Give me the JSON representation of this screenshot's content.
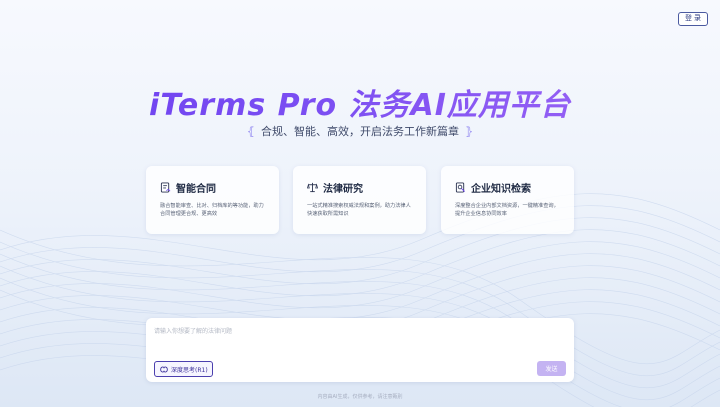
{
  "header": {
    "login_label": "登 录"
  },
  "hero": {
    "title": "iTerms  Pro 法务AI应用平台",
    "subtitle": "合规、智能、高效，开启法务工作新篇章",
    "subtitle_left_mark": "⦃",
    "subtitle_right_mark": "⦄"
  },
  "cards": [
    {
      "icon": "contract-icon",
      "title": "智能合同",
      "desc": "融合智能审查、比对、归档库的等功能，助力合同管理更合规、更高效"
    },
    {
      "icon": "law-icon",
      "title": "法律研究",
      "desc": "一站式精准搜索权威法规和案例，助力法律人快速获取所需知识"
    },
    {
      "icon": "knowledge-icon",
      "title": "企业知识检索",
      "desc": "深度整合企业内部文档资源，一键精准查询，提升企业信息协同效率"
    }
  ],
  "chat": {
    "placeholder": "请输入你想要了解的法律问题",
    "deep_think_label": "深度思考(R1)",
    "send_label": "发送"
  },
  "footer": {
    "note": "内容由AI生成，仅供参考，请注意甄别"
  },
  "colors": {
    "accent": "#7048f0",
    "send_button": "#c4b3f2",
    "card_bg": "#ffffff"
  }
}
